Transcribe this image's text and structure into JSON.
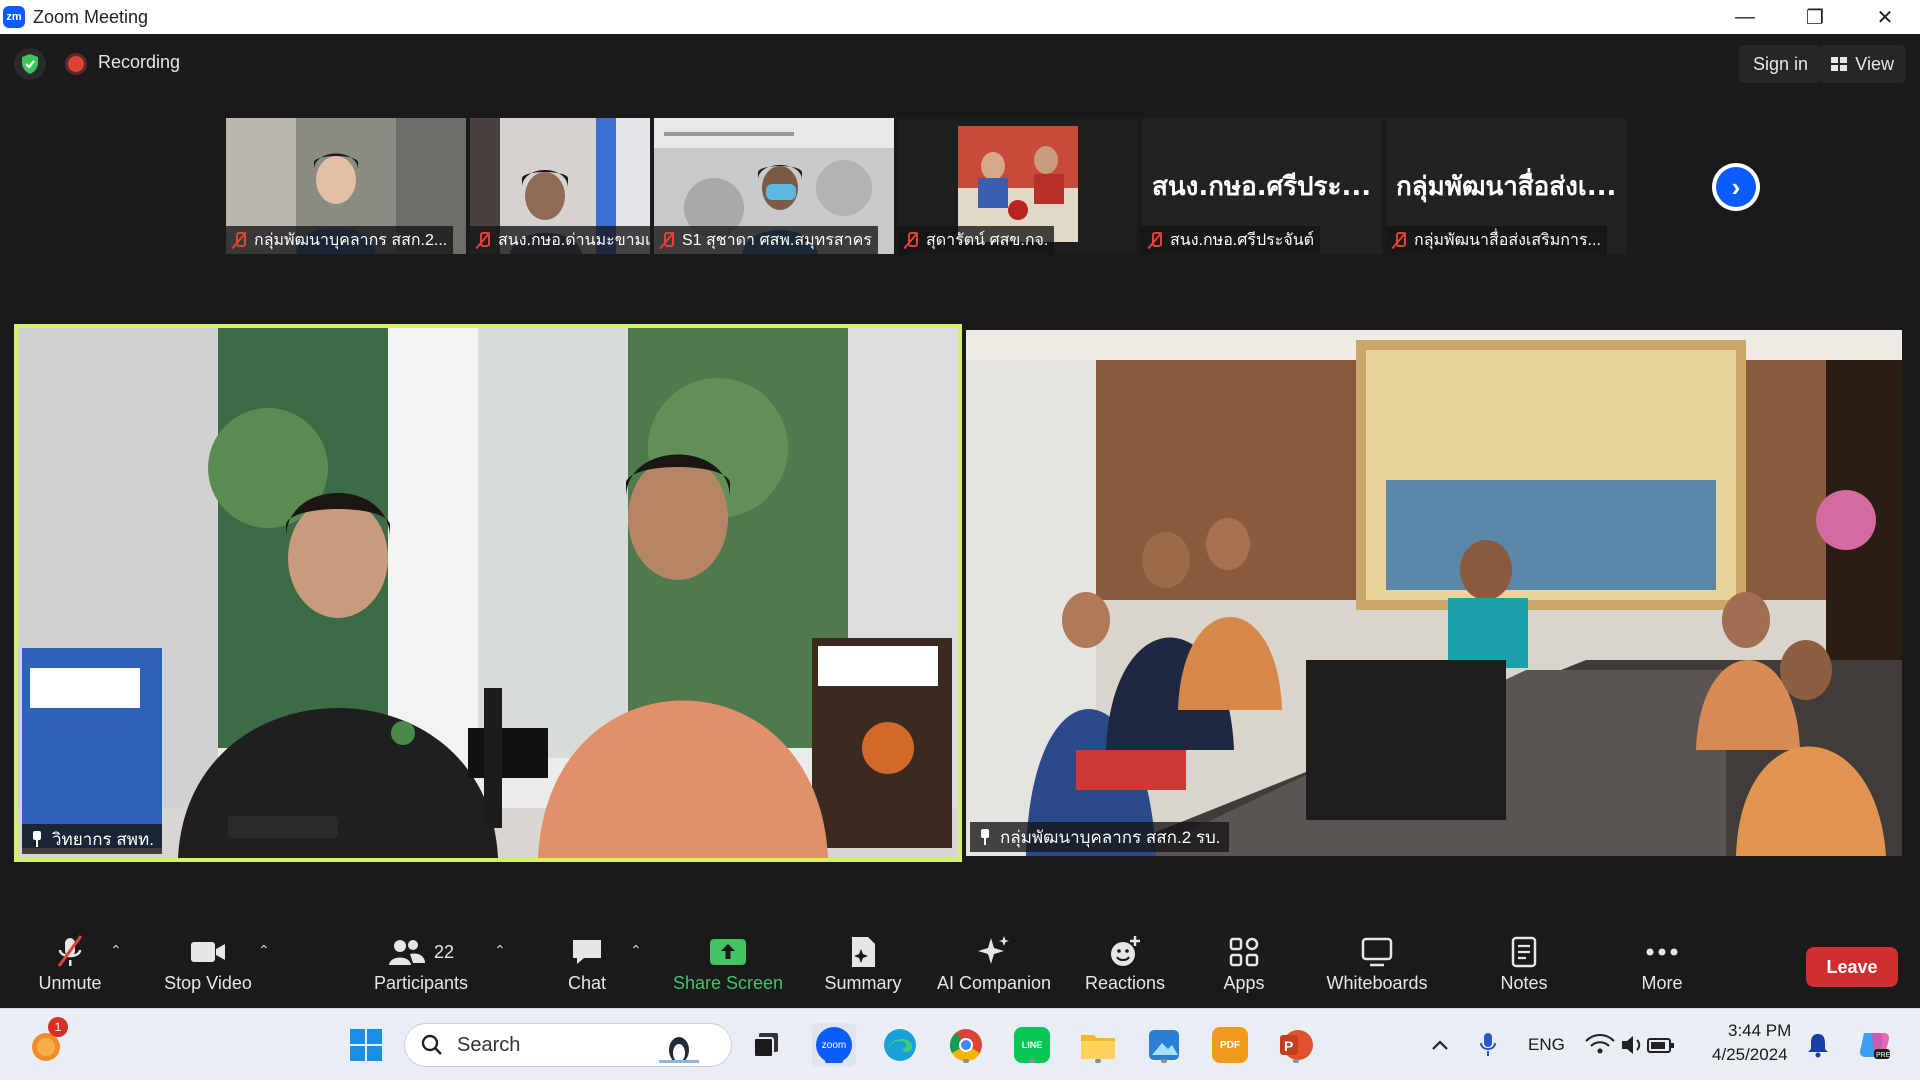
{
  "window": {
    "title": "Zoom Meeting",
    "minimize": "—",
    "restore": "❐",
    "close": "✕",
    "logo": "zm"
  },
  "topbar": {
    "recording": "Recording",
    "sign_in": "Sign in",
    "view": "View"
  },
  "thumbnails": [
    {
      "name": "กลุ่มพัฒนาบุคลากร สสก.2...",
      "type": "video",
      "color": "#7a7f78"
    },
    {
      "name": "สนง.กษอ.ด่านมะขามเตี้ย",
      "type": "video",
      "color": "#6c6a6a"
    },
    {
      "name": "S1 สุชาดา ศสพ.สมุทรสาคร",
      "type": "video",
      "color": "#b8b8b8"
    },
    {
      "name": "สุดารัตน์ ศสข.กจ.",
      "type": "video",
      "color": "#9a4036"
    },
    {
      "name": "สนง.กษอ.ศรีประจันต์",
      "type": "name",
      "display": "สนง.กษอ.ศรีประ..."
    },
    {
      "name": "กลุ่มพัฒนาสื่อส่งเสริมการ...",
      "type": "name",
      "display": "กลุ่มพัฒนาสื่อส่งเ..."
    }
  ],
  "tiles": {
    "left": {
      "name": "วิทยากร สพท."
    },
    "right": {
      "name": "กลุ่มพัฒนาบุคลากร สสก.2 รบ."
    }
  },
  "toolbar": {
    "unmute": "Unmute",
    "stop_video": "Stop Video",
    "participants": "Participants",
    "participants_count": "22",
    "chat": "Chat",
    "share_screen": "Share Screen",
    "summary": "Summary",
    "ai_companion": "AI Companion",
    "reactions": "Reactions",
    "apps": "Apps",
    "whiteboards": "Whiteboards",
    "notes": "Notes",
    "more": "More",
    "leave": "Leave"
  },
  "taskbar": {
    "search": "Search",
    "notification_count": "1",
    "language": "ENG",
    "time": "3:44 PM",
    "date": "4/25/2024",
    "zoom_icon_text": "zoom"
  },
  "colors": {
    "active_border": "#d4f269",
    "leave": "#d12f2f",
    "share": "#43c463",
    "accent": "#0b5cff"
  }
}
